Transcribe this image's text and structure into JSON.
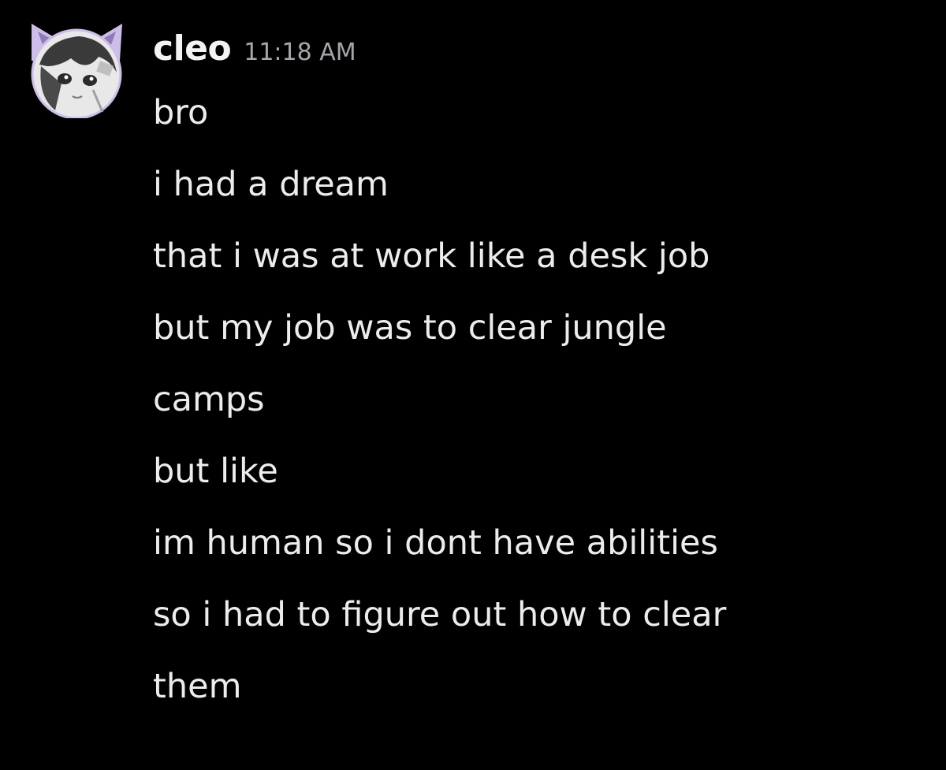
{
  "message": {
    "author": "cleo",
    "timestamp": "11:18 AM",
    "lines": [
      "bro",
      "i had a dream",
      "that i was at work like a desk job",
      "but my job was to clear jungle",
      "camps",
      "but like",
      "im human so i dont have abilities",
      "so i had to figure out how to clear",
      "them"
    ]
  },
  "colors": {
    "background": "#000000",
    "text": "#ececec",
    "timestamp": "#a3a6aa",
    "avatar_frame": "#c9b8e8"
  },
  "icons": {
    "avatar": "anime-avatar-cat-ears"
  }
}
